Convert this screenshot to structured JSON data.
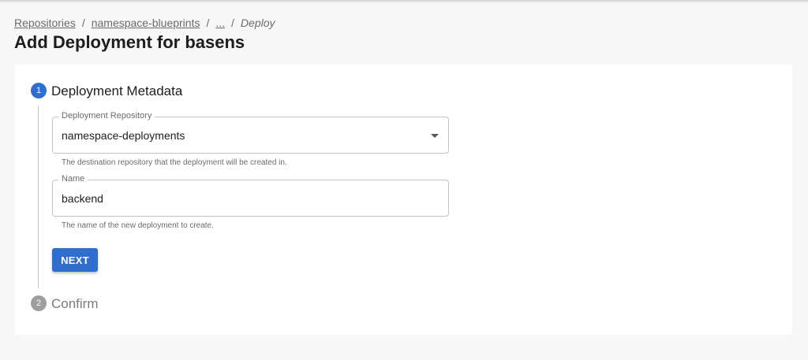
{
  "breadcrumb": {
    "items": [
      "Repositories",
      "namespace-blueprints",
      "..."
    ],
    "separator": "/",
    "current": "Deploy"
  },
  "page": {
    "title": "Add Deployment for basens"
  },
  "stepper": {
    "steps": [
      {
        "number": "1",
        "label": "Deployment Metadata",
        "state": "active"
      },
      {
        "number": "2",
        "label": "Confirm",
        "state": "inactive"
      }
    ]
  },
  "form": {
    "repository": {
      "label": "Deployment Repository",
      "value": "namespace-deployments",
      "helper": "The destination repository that the deployment will be created in."
    },
    "name": {
      "label": "Name",
      "value": "backend",
      "helper": "The name of the new deployment to create."
    },
    "next_label": "NEXT"
  },
  "colors": {
    "accent": "#2f6ecf",
    "inactive_step": "#9e9e9e",
    "background": "#f7f7f7",
    "card": "#ffffff"
  }
}
